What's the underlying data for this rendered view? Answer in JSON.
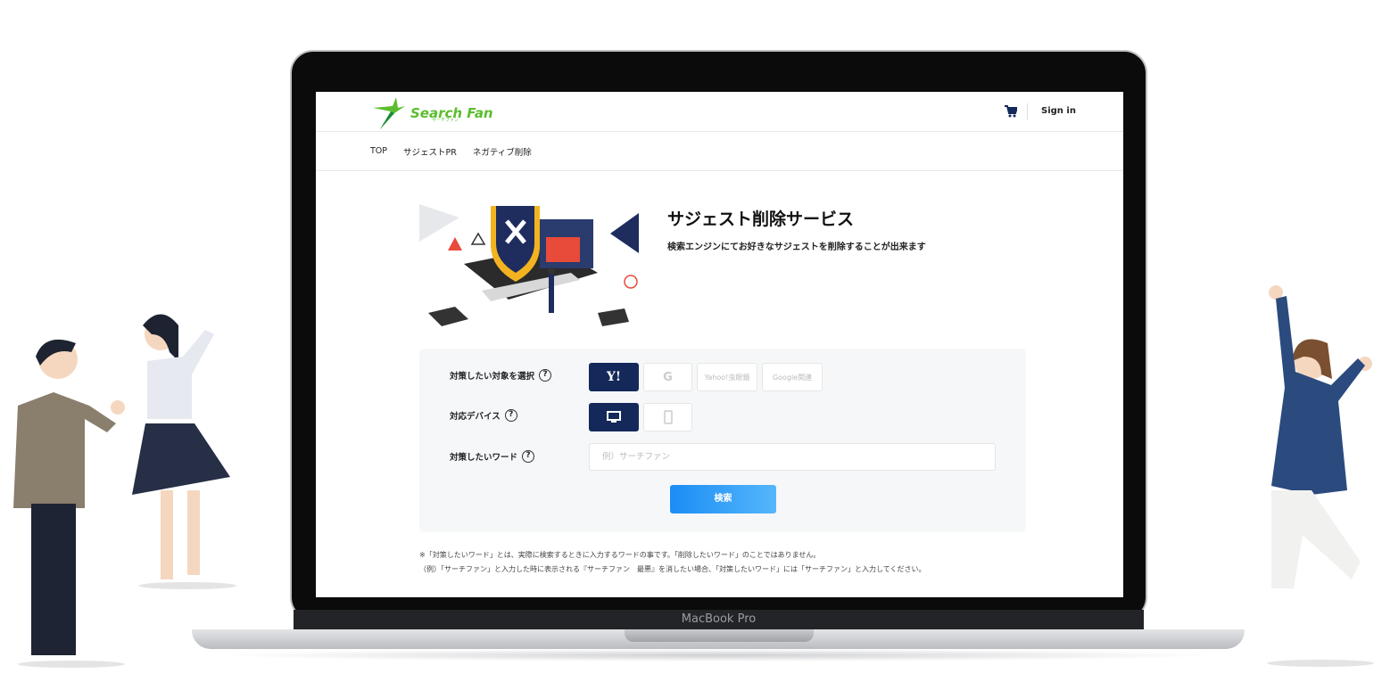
{
  "device": {
    "label": "MacBook Pro"
  },
  "header": {
    "logo_text": "Search Fan",
    "logo_sub": "サーチファン",
    "signin": "Sign in",
    "cart_icon": "cart-icon"
  },
  "nav": {
    "items": [
      "TOP",
      "サジェストPR",
      "ネガティブ削除"
    ]
  },
  "hero": {
    "title": "サジェスト削除サービス",
    "subtitle": "検索エンジンにてお好きなサジェストを削除することが出来ます"
  },
  "form": {
    "target": {
      "label": "対策したい対象を選択",
      "options": [
        "Y!",
        "G",
        "Yahoo!虫眼鏡",
        "Google関連"
      ],
      "selected": "Y!"
    },
    "device": {
      "label": "対応デバイス",
      "options": [
        "desktop",
        "mobile"
      ],
      "selected": "desktop"
    },
    "word": {
      "label": "対策したいワード",
      "placeholder": "例）サーチファン",
      "value": ""
    },
    "search_button": "検索",
    "help": "?"
  },
  "notes": [
    "※「対策したいワード」とは、実際に検索するときに入力するワードの事です。「削除したいワード」のことではありません。",
    "（例）「サーチファン」と入力した時に表示される『サーチファン　最悪』を消したい場合、「対策したいワード」には「サーチファン」と入力してください。"
  ],
  "colors": {
    "brand": "#5bbd2d",
    "navy": "#14285a",
    "button": "#1b8df5"
  }
}
